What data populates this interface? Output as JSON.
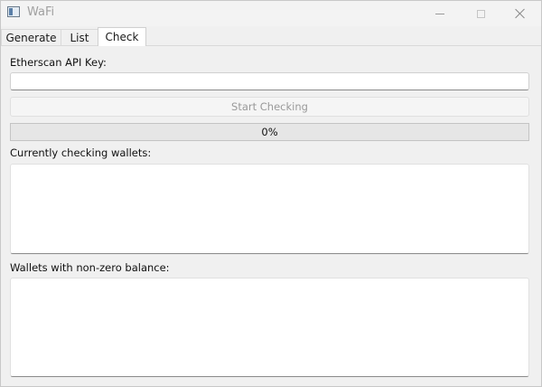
{
  "window": {
    "title": "WaFi",
    "icon": "app-window-icon",
    "controls": {
      "minimize_icon": "minimize-icon",
      "maximize_icon": "maximize-icon",
      "close_icon": "close-icon"
    }
  },
  "tabs": [
    {
      "label": "Generate",
      "active": false
    },
    {
      "label": "List",
      "active": false
    },
    {
      "label": "Check",
      "active": true
    }
  ],
  "check": {
    "api_key_label": "Etherscan API Key:",
    "api_key_value": "",
    "start_button_label": "Start Checking",
    "start_button_enabled": false,
    "progress": {
      "value_percent": 0,
      "text": "0%",
      "fill_color": "#06b025"
    },
    "checking_label": "Currently checking wallets:",
    "checking_content": "",
    "balance_label": "Wallets with non-zero balance:",
    "balance_content": ""
  }
}
